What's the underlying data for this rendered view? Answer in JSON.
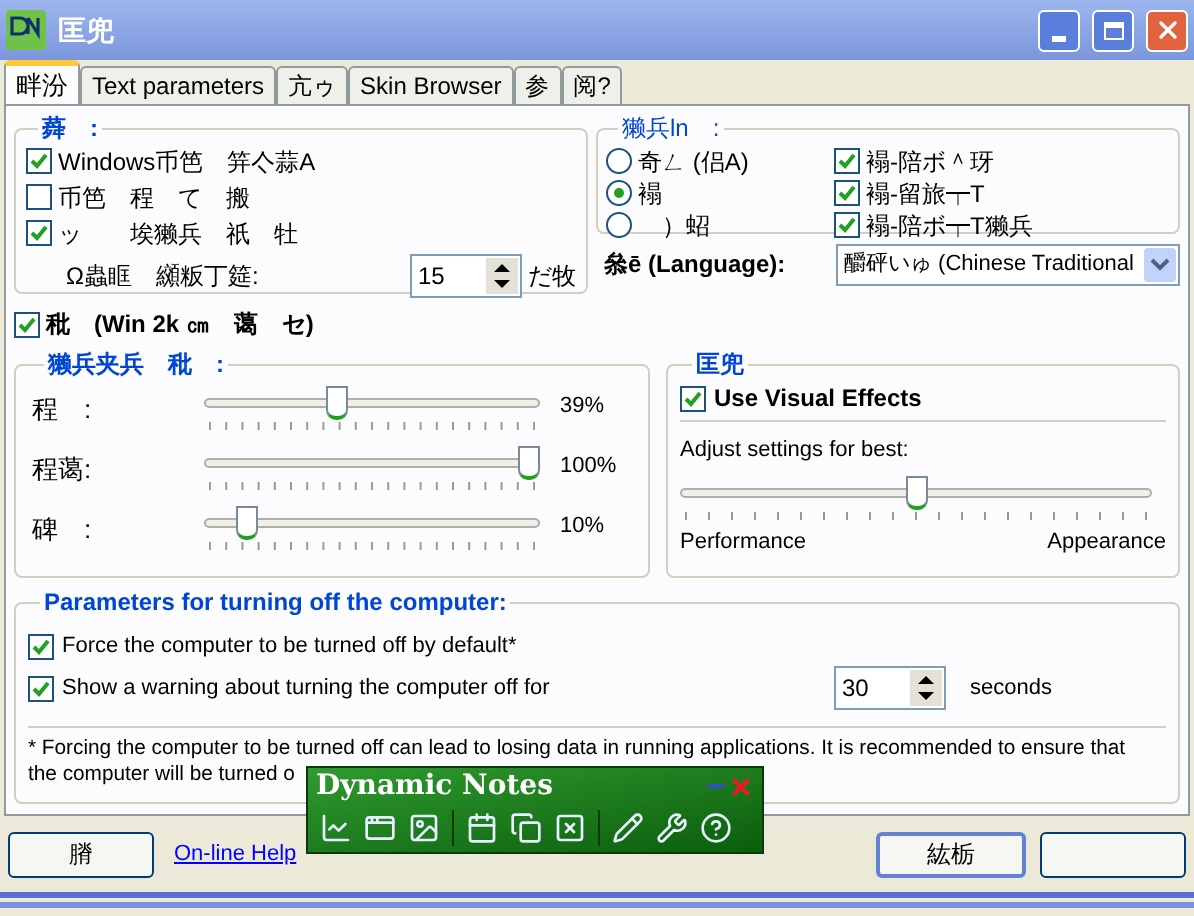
{
  "window": {
    "title": "匡兜"
  },
  "tabs": [
    {
      "label": "畔汾",
      "selected": true
    },
    {
      "label": "Text parameters",
      "selected": false
    },
    {
      "label": "亢ゥ",
      "selected": false
    },
    {
      "label": "Skin Browser",
      "selected": false
    },
    {
      "label": "参",
      "selected": false
    },
    {
      "label": "阅?",
      "selected": false
    }
  ],
  "general": {
    "legend": "蕣　:",
    "options": [
      {
        "label": "Windows币笆　笄亽蒜A",
        "checked": true
      },
      {
        "label": "币笆　程　て　搬",
        "checked": false
      },
      {
        "label": "ッ　　埃獭兵　祇　牡",
        "checked": true
      }
    ],
    "spinner": {
      "label": "Ω蟲眶　纐粄丁筵:",
      "value": "15",
      "unit": "だ牧"
    }
  },
  "display": {
    "legend": "獭兵ln　:",
    "radios": [
      {
        "label": "奇ㄥ (侣A)",
        "selected": false
      },
      {
        "label": "褟",
        "selected": true
      },
      {
        "label": "　）蛁",
        "selected": false
      }
    ],
    "options": [
      {
        "label": "褟-陪ボ＾玡",
        "checked": true
      },
      {
        "label": "褟-留旅┯T",
        "checked": true
      },
      {
        "label": "褟-陪ボ┯T獭兵",
        "checked": true
      }
    ]
  },
  "language": {
    "label": "叅ē (Language):",
    "value": "釂砰いゅ (Chinese Traditional"
  },
  "win2k": {
    "label": "秕　(Win 2k ㎝　蔼　セ)",
    "checked": true
  },
  "transparency": {
    "legend": "獭兵夹兵　秕　:",
    "sliders": [
      {
        "label": "程　:",
        "level": 0.39,
        "reading": "39%"
      },
      {
        "label": "程蔼:",
        "level": 1,
        "reading": "100%"
      },
      {
        "label": "碑　:",
        "level": 0.1,
        "reading": "10%"
      }
    ]
  },
  "effects": {
    "legend": "匡兜",
    "checkbox": {
      "label": "Use Visual Effects",
      "checked": true
    },
    "caption": "Adjust settings for best:",
    "slider": {
      "level": 0.5
    },
    "min_label": "Performance",
    "max_label": "Appearance"
  },
  "shutdown": {
    "legend": "Parameters for turning off the computer:",
    "options": [
      {
        "label": "Force the computer to be turned off by default*",
        "checked": true
      },
      {
        "label": "Show a warning about turning the computer off for",
        "checked": true
      }
    ],
    "spinner": {
      "value": "30",
      "unit": "seconds"
    },
    "note": [
      "* Forcing the computer to be turned off can lead to losing data in running applications. It is recommended to ensure that",
      "the computer will be turned o"
    ]
  },
  "footer": {
    "left_button": "膌",
    "help_link": "On-line Help",
    "ok_button": "紘栃"
  },
  "notes_toolbar": {
    "title": "Dynamic Notes"
  }
}
